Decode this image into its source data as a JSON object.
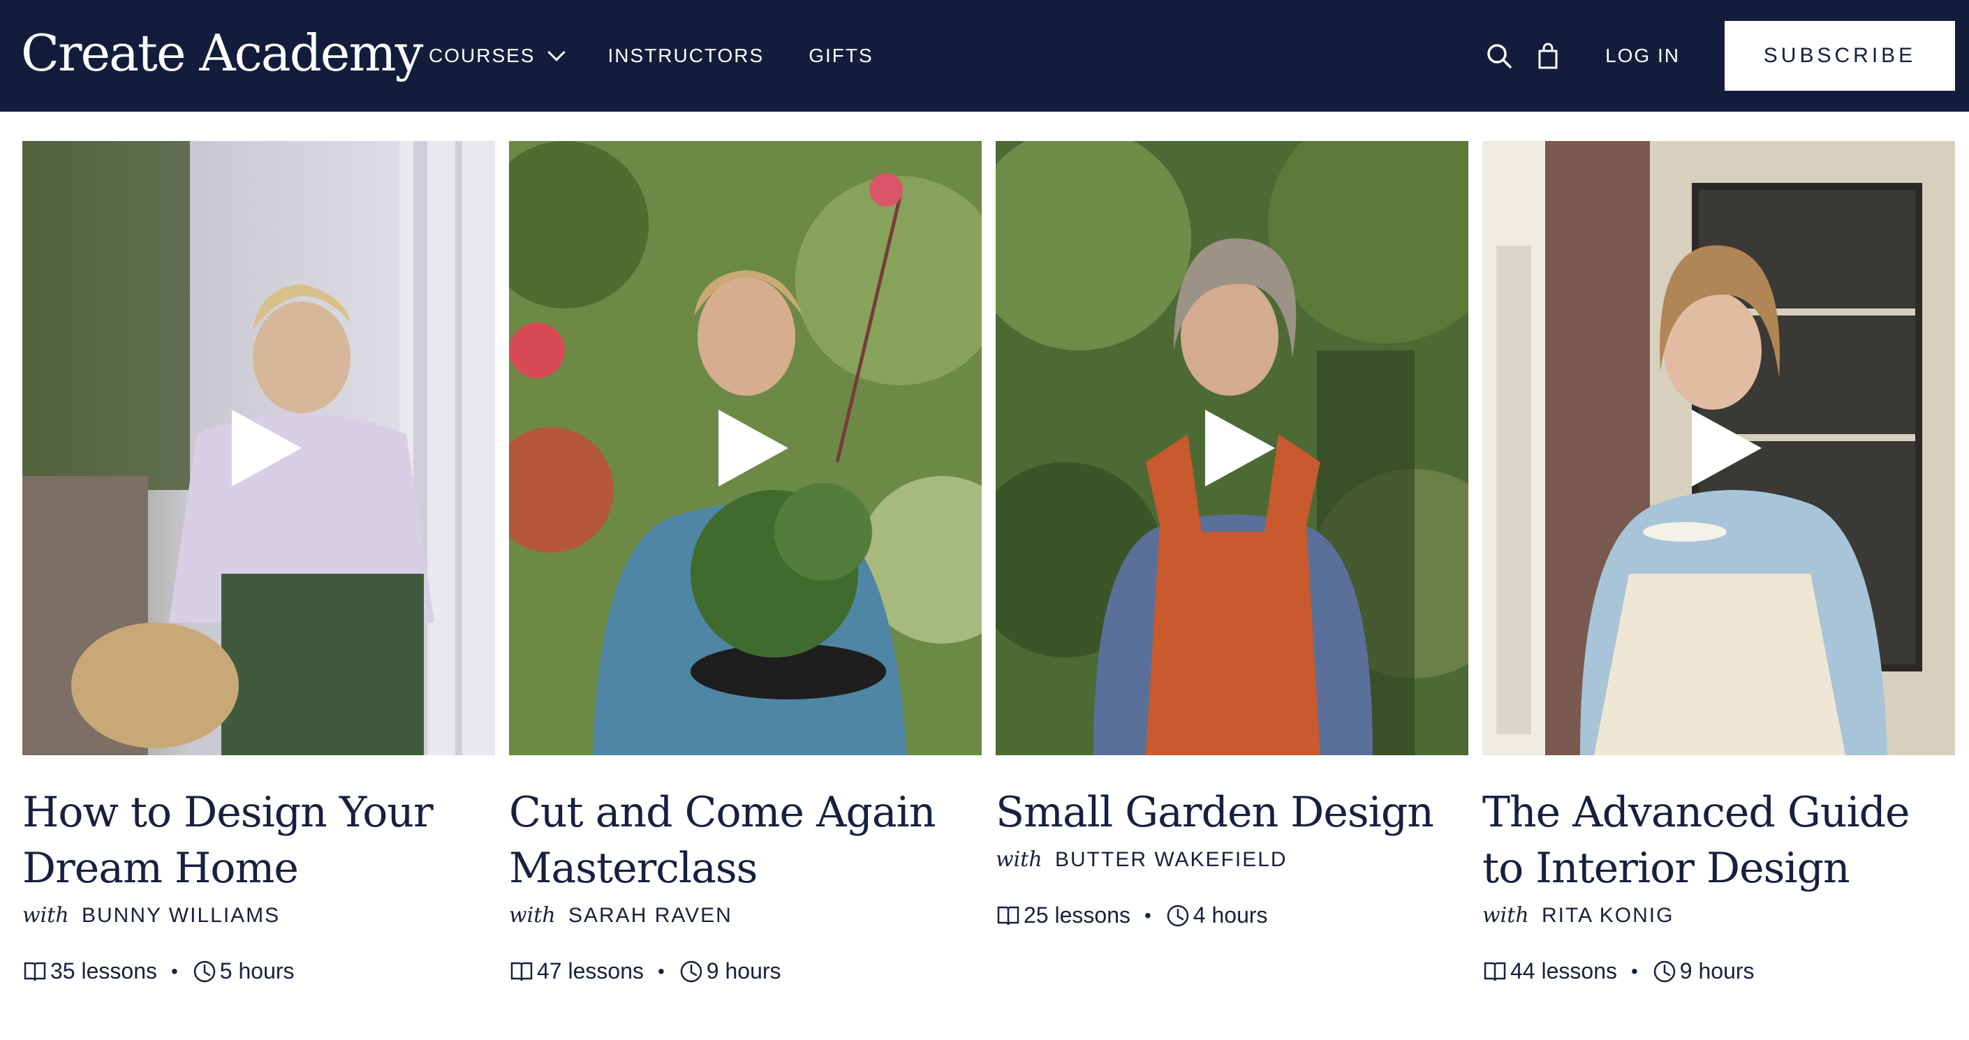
{
  "header": {
    "logo": "Create Academy",
    "nav": [
      {
        "label": "COURSES",
        "has_dropdown": true
      },
      {
        "label": "INSTRUCTORS"
      },
      {
        "label": "GIFTS"
      }
    ],
    "search_icon": "search-icon",
    "cart_icon": "shopping-bag-icon",
    "login_label": "LOG IN",
    "subscribe_label": "SUBSCRIBE"
  },
  "courses": [
    {
      "title": "How to Design Your Dream Home",
      "with": "with",
      "instructor": "BUNNY WILLIAMS",
      "lessons": "35 lessons",
      "hours": "5 hours"
    },
    {
      "title": "Cut and Come Again Masterclass",
      "with": "with",
      "instructor": "SARAH RAVEN",
      "lessons": "47 lessons",
      "hours": "9 hours"
    },
    {
      "title": "Small Garden Design",
      "with": "with",
      "instructor": "BUTTER WAKEFIELD",
      "lessons": "25 lessons",
      "hours": "4 hours"
    },
    {
      "title": "The Advanced Guide to Interior Design",
      "with": "with",
      "instructor": "RITA KONIG",
      "lessons": "44 lessons",
      "hours": "9 hours"
    }
  ],
  "colors": {
    "header_bg": "#131c3b",
    "text": "#16203f",
    "subscribe_bg": "#ffffff"
  }
}
